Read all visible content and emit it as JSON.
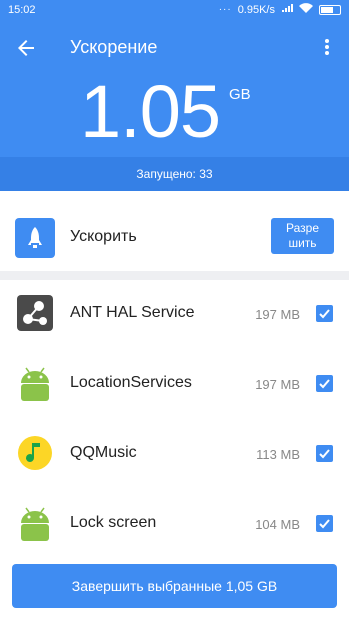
{
  "status_bar": {
    "time": "15:02",
    "dots": "···",
    "net_speed": "0.95K/s"
  },
  "header": {
    "title": "Ускорение",
    "memory_value": "1.05",
    "memory_unit": "GB",
    "running_label": "Запущено: 33"
  },
  "boost": {
    "label": "Ускорить",
    "allow_button": "Разре\nшить"
  },
  "apps": [
    {
      "name": "ANT HAL Service",
      "size": "197 MB",
      "icon": "ant-hal-service-icon",
      "checked": true
    },
    {
      "name": "LocationServices",
      "size": "197 MB",
      "icon": "android-icon",
      "checked": true
    },
    {
      "name": "QQMusic",
      "size": "113 MB",
      "icon": "qqmusic-icon",
      "checked": true
    },
    {
      "name": "Lock screen",
      "size": "104 MB",
      "icon": "android-icon",
      "checked": true
    }
  ],
  "footer": {
    "finish_button": "Завершить выбранные 1,05 GB"
  },
  "colors": {
    "primary": "#3f8cf2",
    "primary_dark": "#3580e6",
    "android_green": "#8bc34a",
    "qq_yellow": "#fcd626"
  }
}
